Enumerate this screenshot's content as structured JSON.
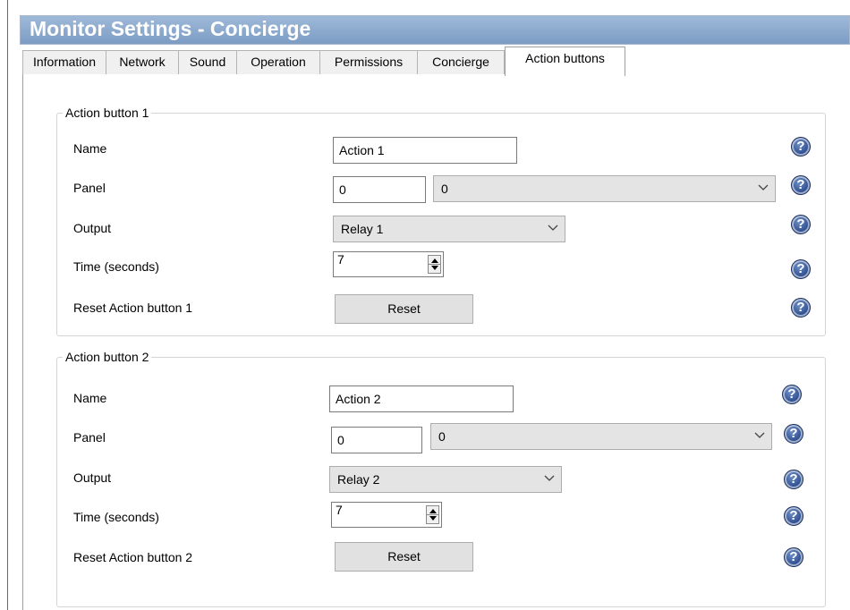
{
  "window": {
    "title": "Monitor Settings - Concierge"
  },
  "tabs": [
    {
      "label": "Information"
    },
    {
      "label": "Network"
    },
    {
      "label": "Sound"
    },
    {
      "label": "Operation"
    },
    {
      "label": "Permissions"
    },
    {
      "label": "Concierge"
    },
    {
      "label": "Action buttons",
      "active": true
    }
  ],
  "groups": [
    {
      "title": "Action button 1",
      "name_label": "Name",
      "name_value": "Action 1",
      "panel_label": "Panel",
      "panel_value": "0",
      "panel_select": "0",
      "output_label": "Output",
      "output_value": "Relay 1",
      "time_label": "Time (seconds)",
      "time_value": "7",
      "reset_label": "Reset Action button 1",
      "reset_button": "Reset"
    },
    {
      "title": "Action button 2",
      "name_label": "Name",
      "name_value": "Action 2",
      "panel_label": "Panel",
      "panel_value": "0",
      "panel_select": "0",
      "output_label": "Output",
      "output_value": "Relay 2",
      "time_label": "Time (seconds)",
      "time_value": "7",
      "reset_label": "Reset Action button 2",
      "reset_button": "Reset"
    }
  ],
  "help_icon": {
    "glyph": "?",
    "name": "help-icon",
    "color": "#27478a"
  },
  "colors": {
    "title_bar": "#8aa8cf",
    "title_text": "#ffffff"
  }
}
